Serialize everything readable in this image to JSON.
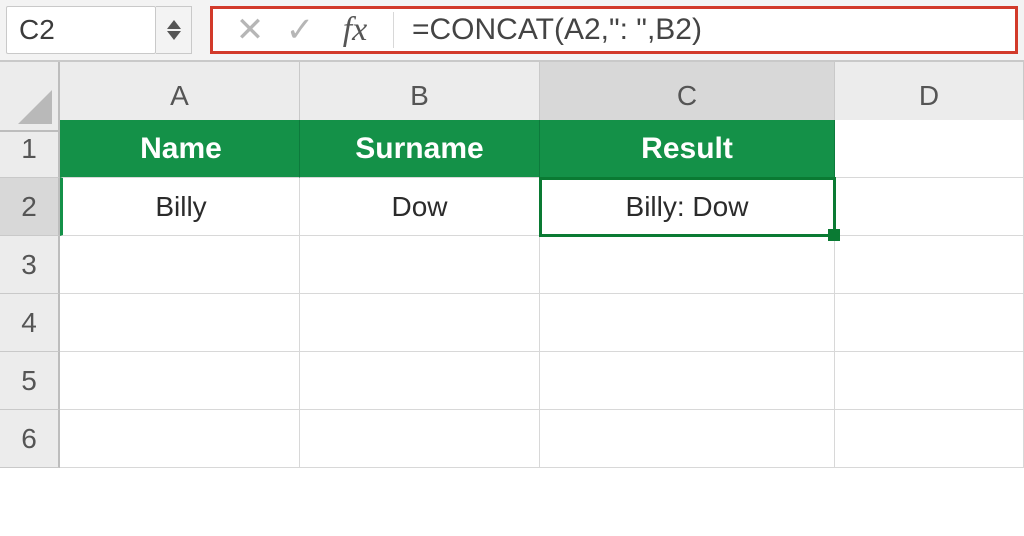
{
  "name_box": {
    "value": "C2"
  },
  "formula_bar": {
    "cancel_glyph": "✕",
    "confirm_glyph": "✓",
    "fx_label": "fx",
    "formula": "=CONCAT(A2,\": \",B2)"
  },
  "columns": [
    "A",
    "B",
    "C",
    "D"
  ],
  "rows": [
    "1",
    "2",
    "3",
    "4",
    "5",
    "6"
  ],
  "active_cell": "C2",
  "headers": {
    "A": "Name",
    "B": "Surname",
    "C": "Result"
  },
  "data": {
    "A2": "Billy",
    "B2": "Dow",
    "C2": "Billy: Dow"
  },
  "colors": {
    "header_bg": "#149148",
    "select_border": "#0a7a33",
    "highlight_box": "#d23a2a"
  }
}
